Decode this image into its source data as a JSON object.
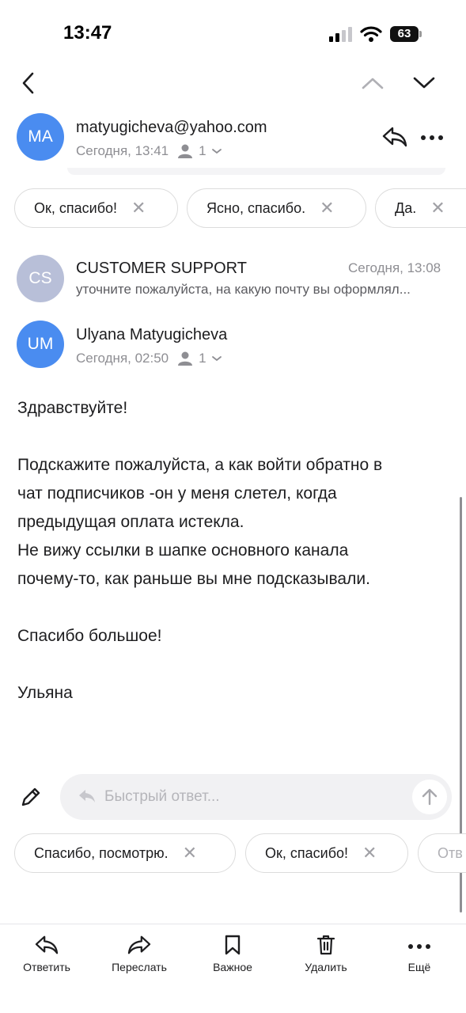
{
  "status_bar": {
    "time": "13:47",
    "battery": "63"
  },
  "email_top": {
    "avatar": "MA",
    "sender": "matyugicheva@yahoo.com",
    "date": "Сегодня, 13:41",
    "recipients": "1"
  },
  "quick_replies_top": [
    "Ок, спасибо!",
    "Ясно, спасибо.",
    "Да."
  ],
  "email_support": {
    "avatar": "CS",
    "sender": "CUSTOMER SUPPORT",
    "date": "Сегодня, 13:08",
    "preview": "уточните пожалуйста, на какую почту вы оформлял..."
  },
  "email_main": {
    "avatar": "UM",
    "sender": "Ulyana Matyugicheva",
    "date": "Сегодня, 02:50",
    "recipients": "1",
    "body": {
      "greeting": "Здравствуйте!",
      "line1": "Подскажите пожалуйста, а как войти обратно в",
      "line2": "чат подписчиков -он у меня слетел, когда",
      "line3": "предыдущая оплата истекла.",
      "line4": "Не вижу ссылки в шапке основного канала",
      "line5": "почему-то, как раньше вы мне подсказывали.",
      "thanks": "Спасибо большое!",
      "signature": "Ульяна"
    }
  },
  "quick_reply": {
    "placeholder": "Быстрый ответ..."
  },
  "quick_replies_bottom": [
    "Спасибо, посмотрю.",
    "Ок, спасибо!",
    "Отв"
  ],
  "tab_bar": {
    "reply": "Ответить",
    "forward": "Переслать",
    "important": "Важное",
    "delete": "Удалить",
    "more": "Ещё"
  },
  "colors": {
    "avatar_blue": "#4a8cf0",
    "avatar_gray": "#b8bfd8",
    "accent": "#1d1d1f"
  }
}
